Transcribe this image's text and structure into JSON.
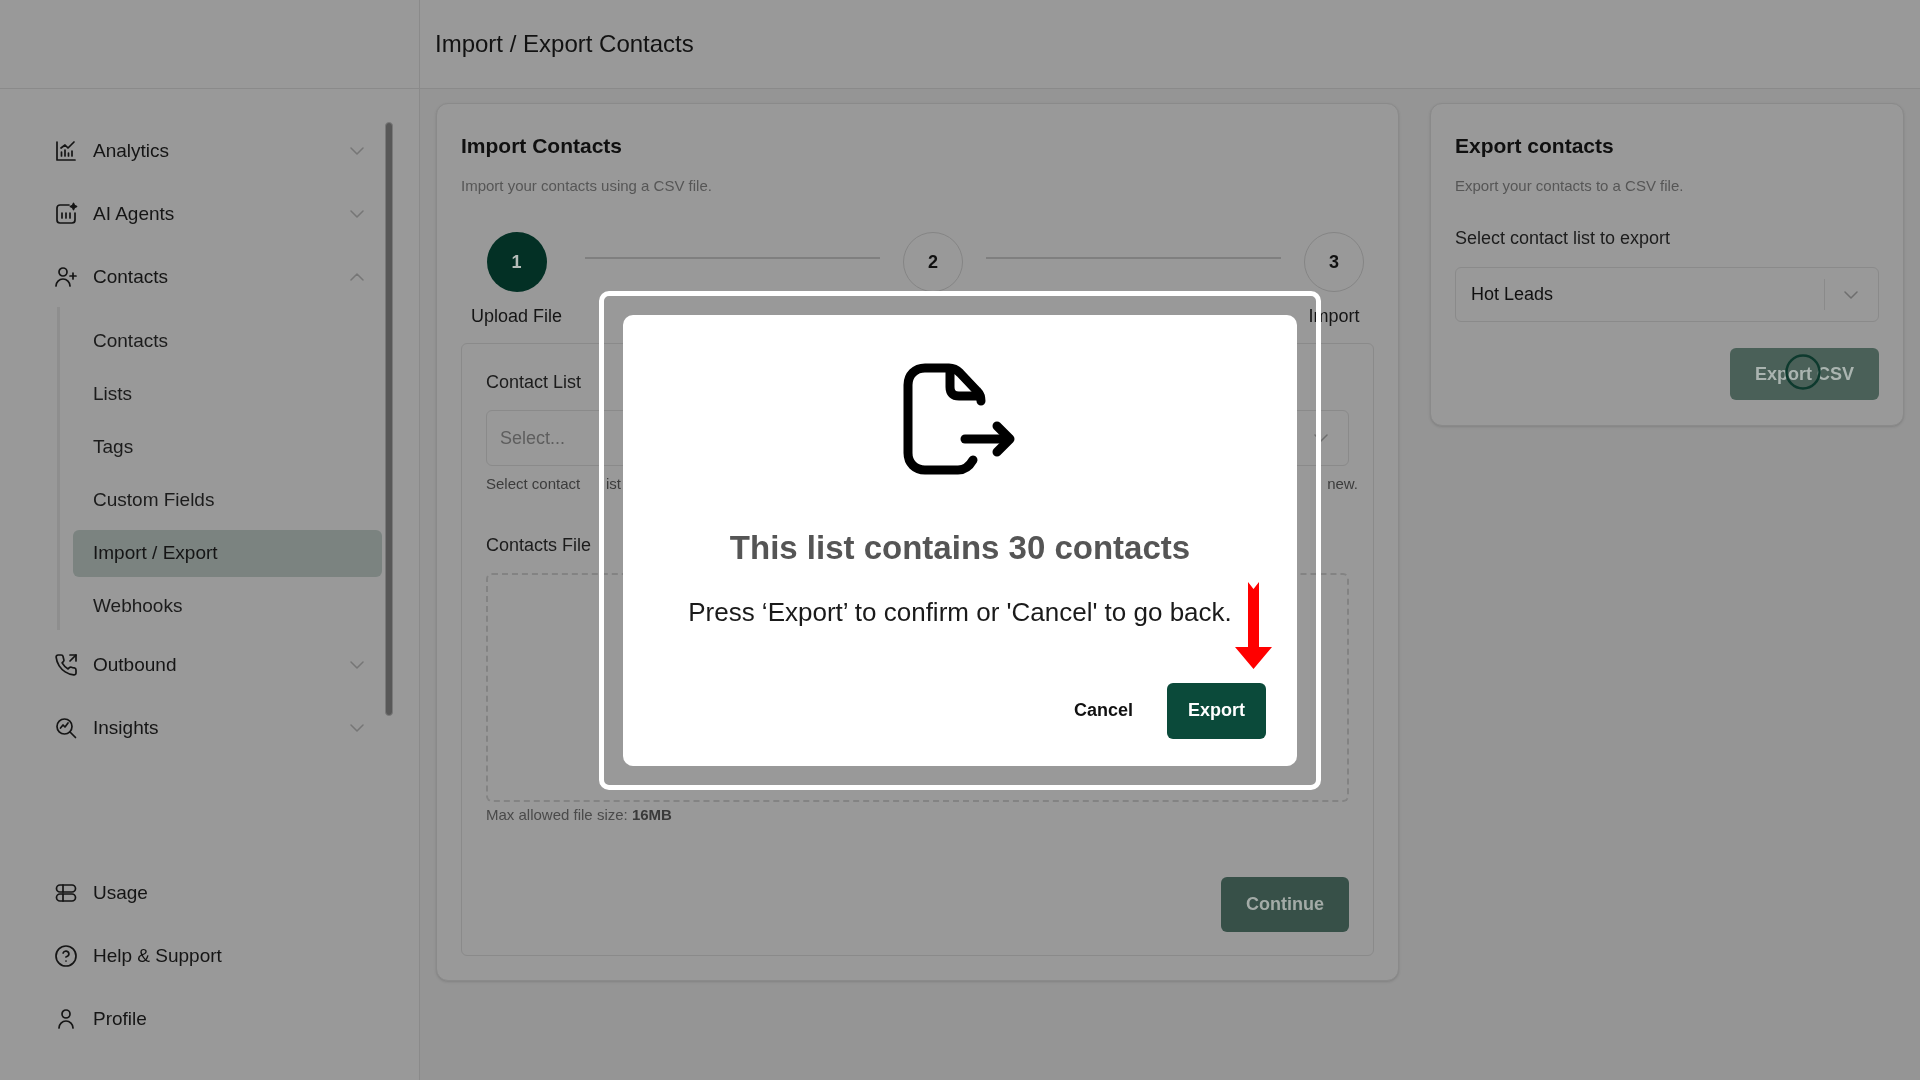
{
  "header": {
    "title": "Import / Export Contacts"
  },
  "sidebar": {
    "items": [
      {
        "label": "Analytics",
        "expanded": false
      },
      {
        "label": "AI Agents",
        "expanded": false
      },
      {
        "label": "Contacts",
        "expanded": true,
        "children": [
          {
            "label": "Contacts",
            "selected": false
          },
          {
            "label": "Lists",
            "selected": false
          },
          {
            "label": "Tags",
            "selected": false
          },
          {
            "label": "Custom Fields",
            "selected": false
          },
          {
            "label": "Import / Export",
            "selected": true
          },
          {
            "label": "Webhooks",
            "selected": false
          }
        ]
      },
      {
        "label": "Outbound",
        "expanded": false
      },
      {
        "label": "Insights",
        "expanded": false
      }
    ],
    "footer_items": [
      {
        "label": "Usage"
      },
      {
        "label": "Help & Support"
      },
      {
        "label": "Profile"
      }
    ]
  },
  "import_card": {
    "title": "Import Contacts",
    "subtitle": "Import your contacts using a CSV file.",
    "steps": [
      {
        "number": "1",
        "label": "Upload File",
        "current": true
      },
      {
        "number": "2",
        "current": false
      },
      {
        "number": "3",
        "label": "Import",
        "current": false
      }
    ],
    "contact_list": {
      "label": "Contact List",
      "placeholder": "Select...",
      "helper_start": "Select contact",
      "helper_fragment": "ist",
      "helper_end": "new."
    },
    "file": {
      "label": "Contacts File",
      "note": "Max allowed file size: **16MB**"
    },
    "continue_button": {
      "label": "Continue",
      "disabled": true
    }
  },
  "export_card": {
    "title": "Export contacts",
    "subtitle": "Export your contacts to a CSV file.",
    "select_label": "Select contact list to export",
    "select_value": "Hot Leads",
    "button": {
      "label": "Export CSV",
      "loading": true
    }
  },
  "dialog": {
    "title": "This list contains 30 contacts",
    "message": "Press ‘Export’ to confirm or 'Cancel' to go back.",
    "buttons": [
      {
        "label": "Cancel",
        "kind": "secondary"
      },
      {
        "label": "Export",
        "kind": "primary"
      }
    ]
  }
}
